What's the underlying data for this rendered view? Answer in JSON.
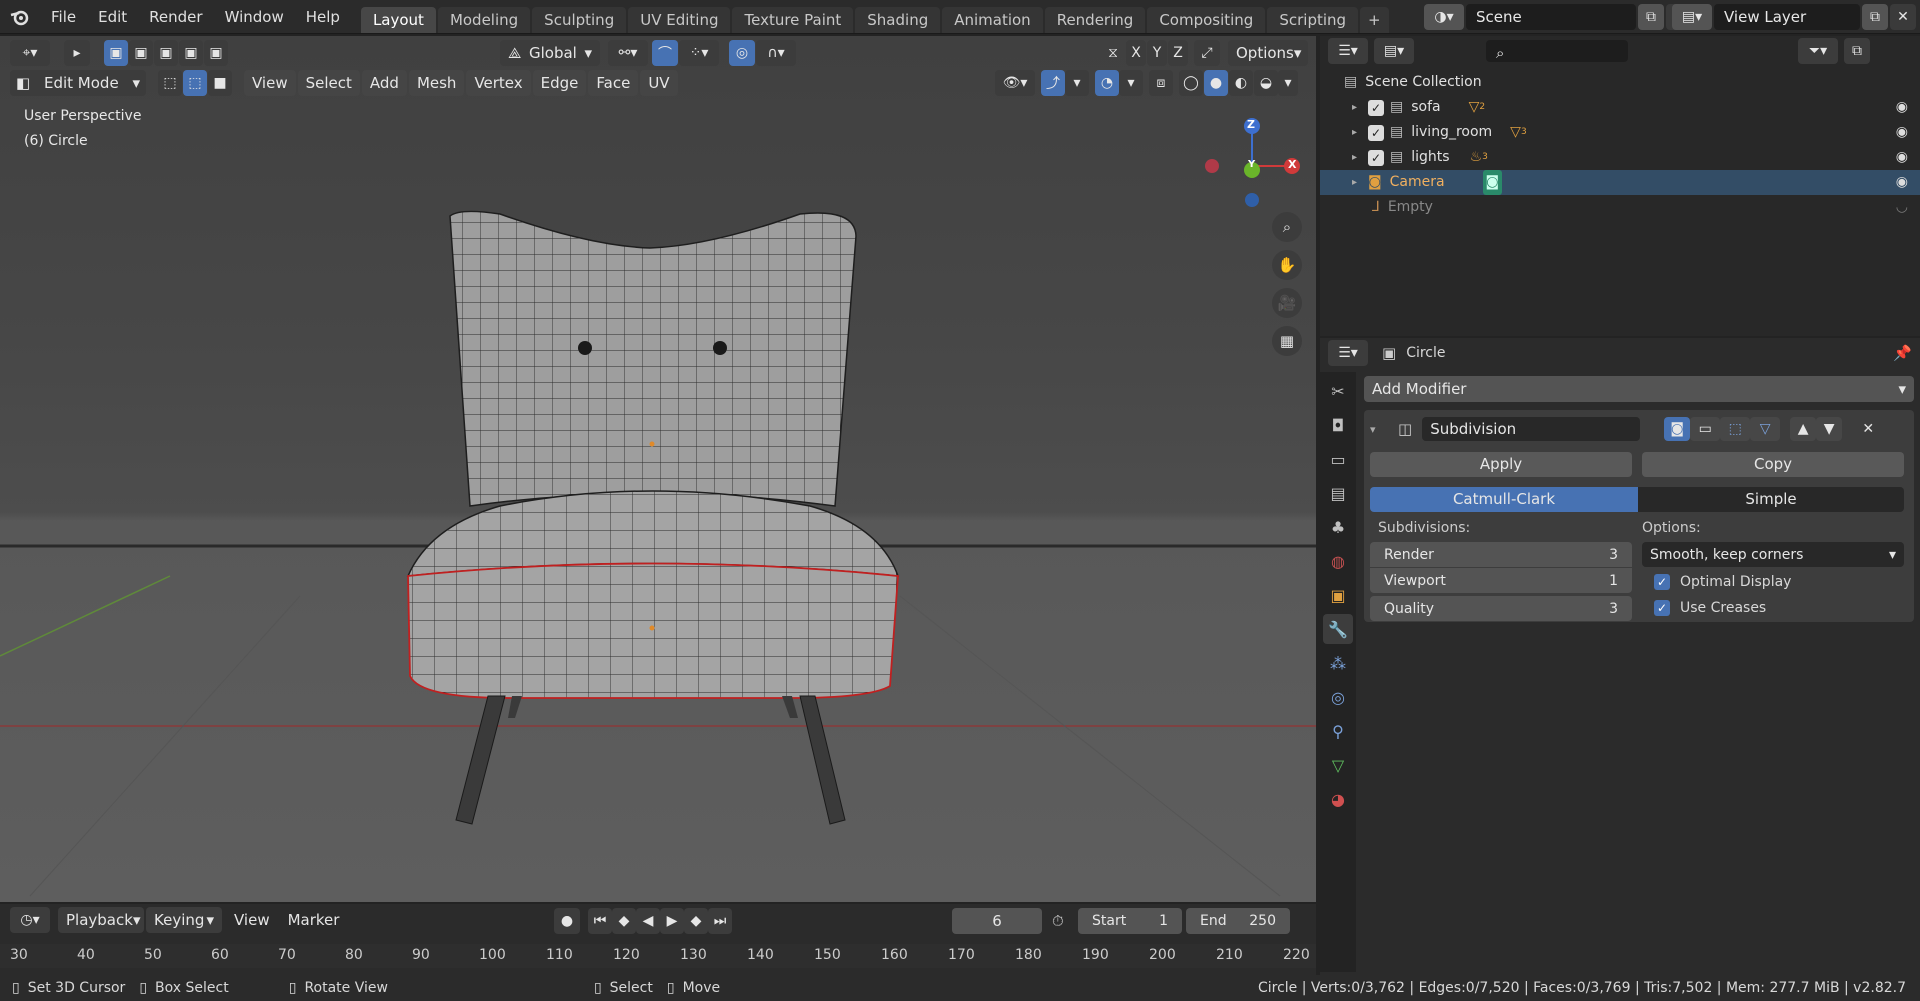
{
  "topbar": {
    "menus": [
      "File",
      "Edit",
      "Render",
      "Window",
      "Help"
    ],
    "workspace_tabs": [
      "Layout",
      "Modeling",
      "Sculpting",
      "UV Editing",
      "Texture Paint",
      "Shading",
      "Animation",
      "Rendering",
      "Compositing",
      "Scripting"
    ],
    "active_tab": "Layout",
    "add_tab": "+",
    "scene_label": "Scene",
    "view_layer_label": "View Layer"
  },
  "viewport": {
    "mode": "Edit Mode",
    "menus": [
      "View",
      "Select",
      "Add",
      "Mesh",
      "Vertex",
      "Edge",
      "Face",
      "UV"
    ],
    "transform_orientation": "Global",
    "axes": [
      "X",
      "Y",
      "Z"
    ],
    "options_label": "Options",
    "overlay_line1": "User Perspective",
    "overlay_line2": "(6) Circle",
    "gizmo": {
      "z": "Z",
      "y": "Y",
      "x": "X"
    }
  },
  "outliner": {
    "root": "Scene Collection",
    "items": [
      {
        "name": "sofa",
        "badge": "2"
      },
      {
        "name": "living_room",
        "badge": "3"
      },
      {
        "name": "lights",
        "badge": "3"
      },
      {
        "name": "Camera",
        "badge": ""
      },
      {
        "name": "Empty",
        "badge": ""
      }
    ]
  },
  "properties": {
    "object_name": "Circle",
    "add_modifier": "Add Modifier",
    "modifier_name": "Subdivision",
    "apply": "Apply",
    "copy": "Copy",
    "algorithms": [
      "Catmull-Clark",
      "Simple"
    ],
    "active_algorithm": "Catmull-Clark",
    "subdivisions_label": "Subdivisions:",
    "options_label": "Options:",
    "render_label": "Render",
    "render_value": "3",
    "viewport_label": "Viewport",
    "viewport_value": "1",
    "quality_label": "Quality",
    "quality_value": "3",
    "uv_smooth": "Smooth, keep corners",
    "optimal_display": "Optimal Display",
    "use_creases": "Use Creases"
  },
  "timeline": {
    "menus": [
      "Playback",
      "Keying",
      "View",
      "Marker"
    ],
    "current_frame": "6",
    "start_label": "Start",
    "start_value": "1",
    "end_label": "End",
    "end_value": "250",
    "ruler": [
      "30",
      "40",
      "50",
      "60",
      "70",
      "80",
      "90",
      "100",
      "110",
      "120",
      "130",
      "140",
      "150",
      "160",
      "170",
      "180",
      "190",
      "200",
      "210",
      "220"
    ]
  },
  "statusbar": {
    "hints": [
      "Set 3D Cursor",
      "Box Select",
      "Rotate View",
      "Select",
      "Move"
    ],
    "stats": "Circle | Verts:0/3,762 | Edges:0/7,520 | Faces:0/3,769 | Tris:7,502 | Mem: 277.7 MiB | v2.82.7"
  }
}
